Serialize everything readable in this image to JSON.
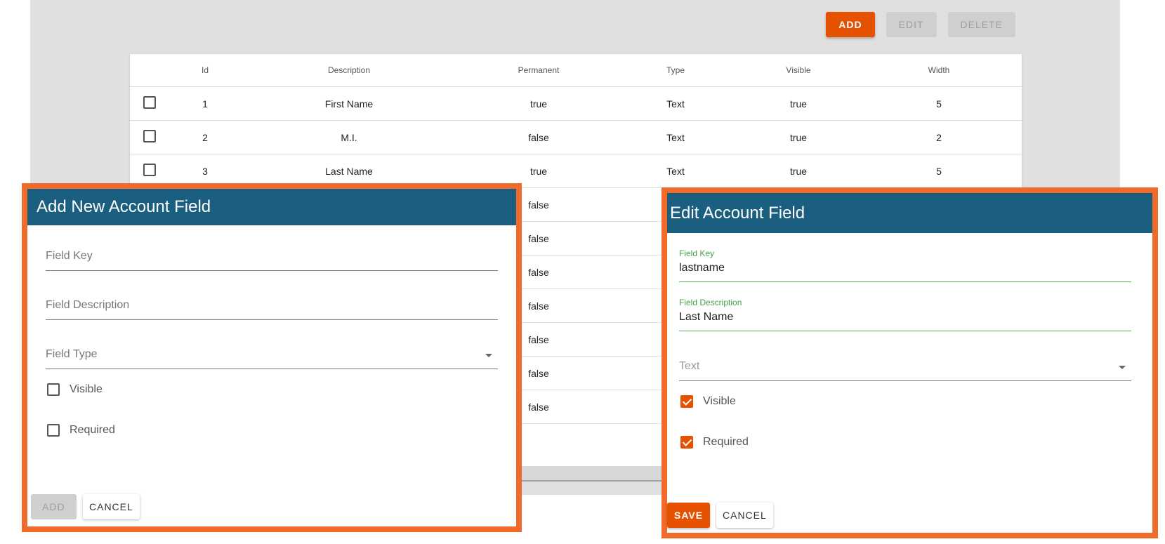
{
  "toolbar": {
    "add": "ADD",
    "edit": "EDIT",
    "delete": "DELETE"
  },
  "table": {
    "headers": {
      "id": "Id",
      "description": "Description",
      "permanent": "Permanent",
      "type": "Type",
      "visible": "Visible",
      "width": "Width"
    },
    "rows": [
      {
        "id": "1",
        "description": "First Name",
        "permanent": "true",
        "type": "Text",
        "visible": "true",
        "width": "5"
      },
      {
        "id": "2",
        "description": "M.I.",
        "permanent": "false",
        "type": "Text",
        "visible": "true",
        "width": "2"
      },
      {
        "id": "3",
        "description": "Last Name",
        "permanent": "true",
        "type": "Text",
        "visible": "true",
        "width": "5"
      },
      {
        "permanent": "false"
      },
      {
        "permanent": "false"
      },
      {
        "permanent": "false"
      },
      {
        "permanent": "false"
      },
      {
        "permanent": "false"
      },
      {
        "permanent": "false"
      },
      {
        "permanent": "false"
      }
    ]
  },
  "add_dialog": {
    "title": "Add New Account Field",
    "field_key_placeholder": "Field Key",
    "field_description_placeholder": "Field Description",
    "field_type_placeholder": "Field Type",
    "visible_label": "Visible",
    "required_label": "Required",
    "add_button": "ADD",
    "cancel_button": "CANCEL"
  },
  "edit_dialog": {
    "title": "Edit Account Field",
    "field_key_label": "Field Key",
    "field_key_value": "lastname",
    "field_description_label": "Field Description",
    "field_description_value": "Last Name",
    "field_type_value": "Text",
    "visible_label": "Visible",
    "visible_checked": true,
    "required_label": "Required",
    "required_checked": true,
    "save_button": "SAVE",
    "cancel_button": "CANCEL"
  },
  "colors": {
    "accent": "#e65100",
    "dialog_header": "#1a5f7f",
    "highlight_border": "#f06a2a",
    "active_field": "#43a047"
  }
}
